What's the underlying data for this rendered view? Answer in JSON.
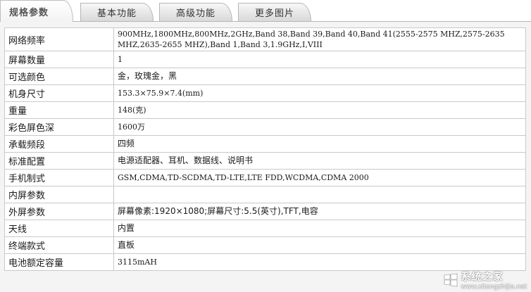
{
  "tabs": [
    {
      "label": "规格参数"
    },
    {
      "label": "基本功能"
    },
    {
      "label": "高级功能"
    },
    {
      "label": "更多图片"
    }
  ],
  "specs": [
    {
      "label": "网络频率",
      "value": "900MHz,1800MHz,800MHz,2GHz,Band 38,Band 39,Band 40,Band 41(2555-2575 MHZ,2575-2635 MHZ,2635-2655 MHZ),Band 1,Band 3,1.9GHz,I,VIII"
    },
    {
      "label": "屏幕数量",
      "value": "1"
    },
    {
      "label": "可选颜色",
      "value": "金，玫瑰金，黑"
    },
    {
      "label": "机身尺寸",
      "value": "153.3×75.9×7.4(mm)"
    },
    {
      "label": "重量",
      "value": "148(克)"
    },
    {
      "label": "彩色屏色深",
      "value": "1600万"
    },
    {
      "label": "承载频段",
      "value": "四频"
    },
    {
      "label": "标准配置",
      "value": "电源适配器、耳机、数据线、说明书"
    },
    {
      "label": "手机制式",
      "value": "GSM,CDMA,TD-SCDMA,TD-LTE,LTE FDD,WCDMA,CDMA 2000"
    },
    {
      "label": "内屏参数",
      "value": ""
    },
    {
      "label": "外屏参数",
      "value": "屏幕像素:1920×1080;屏幕尺寸:5.5(英寸),TFT,电容"
    },
    {
      "label": "天线",
      "value": "内置"
    },
    {
      "label": "终端款式",
      "value": "直板"
    },
    {
      "label": "电池额定容量",
      "value": "3115mAH"
    }
  ],
  "watermark": {
    "text": "系统之家",
    "url": "www.xitongzhijia.net",
    "icon": "windows-logo-icon"
  }
}
